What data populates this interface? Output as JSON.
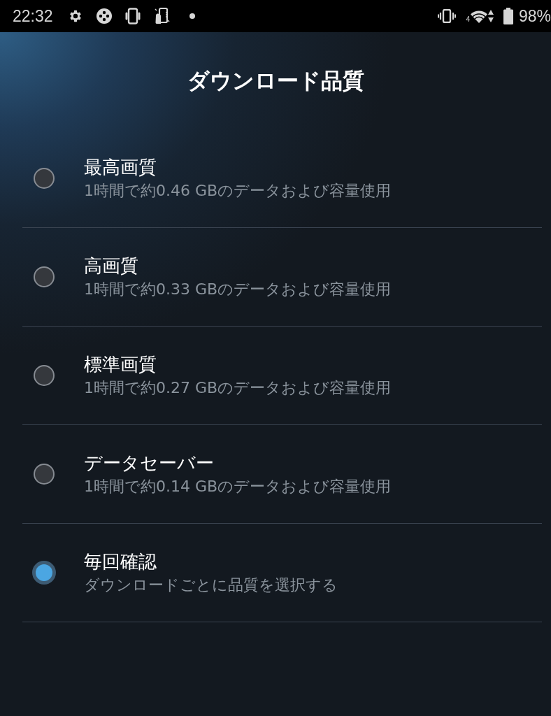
{
  "status_bar": {
    "time": "22:32",
    "network_type": "4",
    "battery": "98%"
  },
  "title": "ダウンロード品質",
  "options": [
    {
      "label": "最高画質",
      "description": "1時間で約0.46 GBのデータおよび容量使用",
      "selected": false
    },
    {
      "label": "高画質",
      "description": "1時間で約0.33 GBのデータおよび容量使用",
      "selected": false
    },
    {
      "label": "標準画質",
      "description": "1時間で約0.27 GBのデータおよび容量使用",
      "selected": false
    },
    {
      "label": "データセーバー",
      "description": "1時間で約0.14 GBのデータおよび容量使用",
      "selected": false
    },
    {
      "label": "毎回確認",
      "description": "ダウンロードごとに品質を選択する",
      "selected": true
    }
  ]
}
